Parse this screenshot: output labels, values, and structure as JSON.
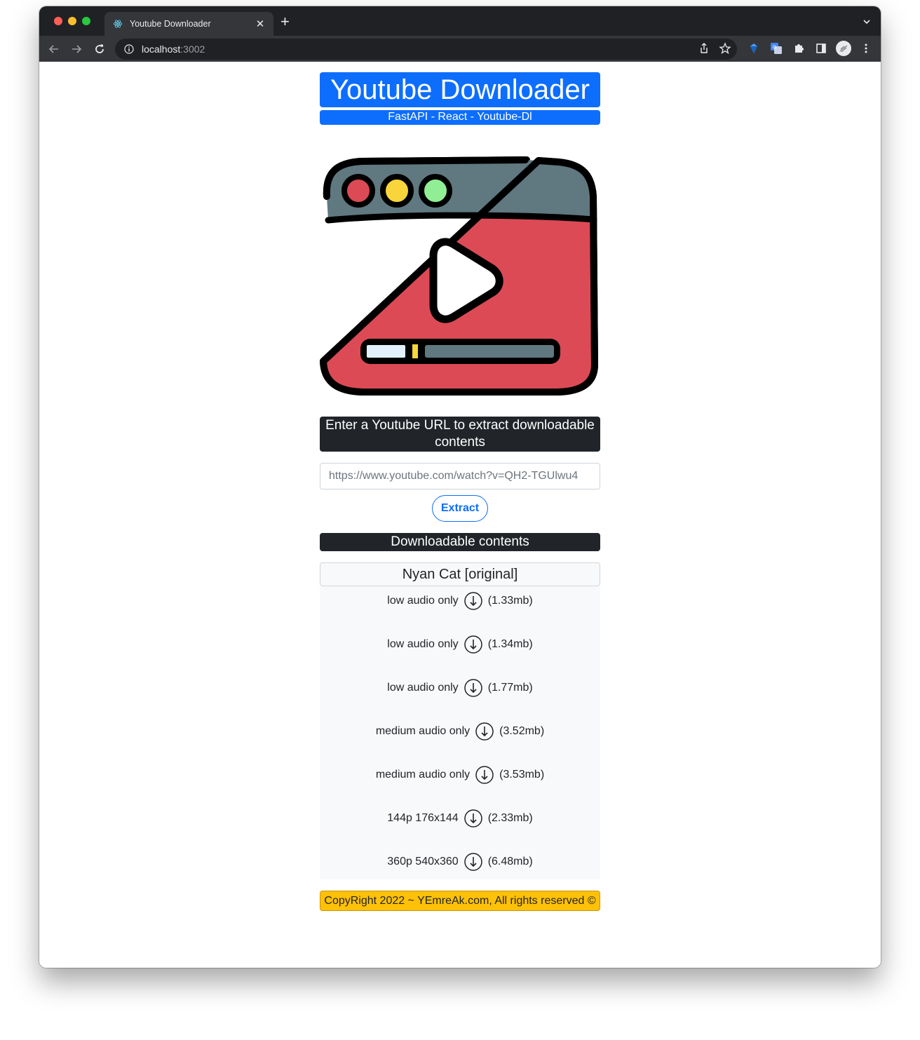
{
  "browser": {
    "tab_title": "Youtube Downloader",
    "tab_close": "✕",
    "new_tab": "+",
    "url_host": "localhost",
    "url_port": ":3002"
  },
  "header": {
    "title": "Youtube Downloader",
    "subtitle": "FastAPI - React - Youtube-Dl"
  },
  "form": {
    "prompt": "Enter a Youtube URL to extract downloadable contents",
    "url_placeholder": "https://www.youtube.com/watch?v=QH2-TGUlwu4",
    "extract_label": "Extract"
  },
  "downloads": {
    "header": "Downloadable contents",
    "video_title": "Nyan Cat [original]",
    "items": [
      {
        "label": "low audio only",
        "size": "(1.33mb)"
      },
      {
        "label": "low audio only",
        "size": "(1.34mb)"
      },
      {
        "label": "low audio only",
        "size": "(1.77mb)"
      },
      {
        "label": "medium audio only",
        "size": "(3.52mb)"
      },
      {
        "label": "medium audio only",
        "size": "(3.53mb)"
      },
      {
        "label": "144p 176x144",
        "size": "(2.33mb)"
      },
      {
        "label": "360p 540x360",
        "size": "(6.48mb)"
      }
    ]
  },
  "footer": {
    "text": "CopyRight 2022 ~ YEmreAk.com, All rights reserved ©"
  },
  "colors": {
    "primary": "#0d6efd",
    "dark": "#212529",
    "warning": "#ffc107",
    "player_red": "#dc4a55",
    "player_gray": "#607880"
  },
  "icons": [
    "react-icon",
    "back-icon",
    "forward-icon",
    "reload-icon",
    "info-icon",
    "share-icon",
    "star-icon",
    "extension-icon",
    "translate-icon",
    "puzzle-icon",
    "sidebar-icon",
    "profile-icon",
    "menu-icon",
    "download-icon",
    "video-player-illustration"
  ]
}
